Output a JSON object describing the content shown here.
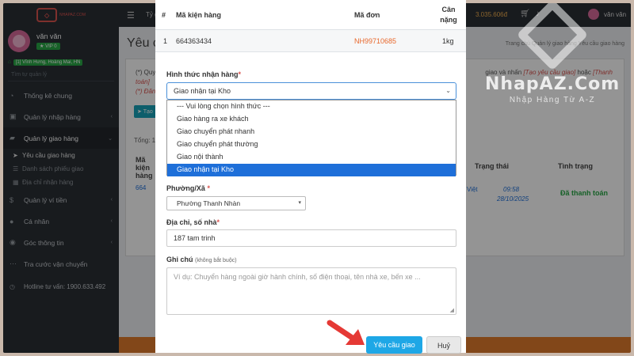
{
  "brand": {
    "logo_text": "NHAPAZ.COM"
  },
  "sidebar": {
    "user_name": "văn văn",
    "vip": "VIP 0",
    "location": "[1] Vĩnh Hưng, Hoàng Mai, HN",
    "search_placeholder": "Tìm tự quản lý",
    "items": [
      {
        "label": "Thống kê chung",
        "icon": "dashboard-icon"
      },
      {
        "label": "Quản lý nhập hàng",
        "icon": "box-icon"
      },
      {
        "label": "Quản lý giao hàng",
        "icon": "truck-icon"
      },
      {
        "label": "Quản lý ví tiền",
        "icon": "wallet-icon"
      },
      {
        "label": "Cá nhân",
        "icon": "user-icon"
      },
      {
        "label": "Góc thông tin",
        "icon": "info-icon"
      },
      {
        "label": "Tra cước vận chuyển",
        "icon": "calc-icon"
      }
    ],
    "subitems": [
      "Yêu cầu giao hàng",
      "Danh sách phiếu giao",
      "Địa chỉ nhận hàng"
    ],
    "hotline": "Hotline tư vấn: 1900.633.492"
  },
  "topbar": {
    "rate": "Tỷ g",
    "balance": "3.035.606đ",
    "user": "văn văn"
  },
  "background": {
    "page_title": "Yêu c",
    "crumbs": "Trang chủ   Quản lý giao hàng   Yêu cầu giao hàng",
    "note1": "(*) Quy",
    "note1_tail": "giao và nhấn",
    "note1_red": "[Tạo yêu cầu giao]",
    "note1_tail2": "hoặc",
    "note1_red2": "[Thanh",
    "note2_red": "toán]",
    "note3": "(*) Đăng",
    "create_btn": "Tạo",
    "total": "Tổng: 1",
    "th_code": "Mã kiện hàng",
    "th_status": "Trạng thái",
    "th_state": "Tình trạng",
    "td_code": "664",
    "td_viet": "Việt",
    "td_time": "09:58",
    "td_date": "28/10/2025",
    "td_state": "Đã thanh toán"
  },
  "watermark": {
    "title": "NhapAZ.Com",
    "subtitle": "Nhập Hàng Từ A-Z"
  },
  "modal": {
    "table": {
      "headers": [
        "#",
        "Mã kiện hàng",
        "Mã đơn",
        "Cân nặng"
      ],
      "rows": [
        [
          "1",
          "664363434",
          "NH99710685",
          "1kg"
        ]
      ]
    },
    "method_label": "Hình thức nhận hàng",
    "method_value": "Giao nhận tại Kho",
    "method_options": [
      "--- Vui lòng chọn hình thức ---",
      "Giao hàng ra xe khách",
      "Giao chuyển phát nhanh",
      "Giao chuyển phát thường",
      "Giao nội thành",
      "Giao nhận tại Kho"
    ],
    "ward_label": "Phường/Xã",
    "ward_value": "Phường Thanh Nhàn",
    "address_label": "Địa chỉ, số nhà",
    "address_value": "187 tam trinh",
    "note_label": "Ghi chú",
    "note_hint": "(không bắt buộc)",
    "note_placeholder": "Ví dụ: Chuyển hàng ngoài giờ hành chính, số điện thoại, tên nhà xe, bến xe ...",
    "required_mark": "*",
    "submit_label": "Yêu cầu giao",
    "cancel_label": "Huỷ"
  },
  "colors": {
    "accent": "#1ea7e6",
    "order_link": "#e8682c",
    "selected_option": "#1e6fd9",
    "arrow": "#e53935"
  }
}
